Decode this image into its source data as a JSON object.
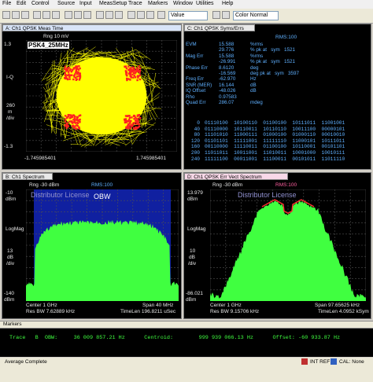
{
  "menu": [
    "File",
    "Edit",
    "Control",
    "Source",
    "Input",
    "MeasSetup",
    "Trace",
    "Markers",
    "Window",
    "Utilities",
    "Help"
  ],
  "toolbar": {
    "value_display": "Value",
    "color_mode": "Color Normal"
  },
  "panelA": {
    "title": "A: Ch1 QPSK Meas Time",
    "rng": "Rng 10 mV",
    "overlay_label": "PSK4_25MHz",
    "y_top": "1.3",
    "y_mid_label": "I-Q",
    "y_scale1": "260",
    "y_scale2": "m",
    "y_scale3": "/div",
    "y_bottom": "-1.3",
    "x_left": "-1.745985401",
    "x_right": "1.745985401",
    "scatter_color": "#ffff00",
    "point_color": "#ff2020"
  },
  "panelC": {
    "title": "C: Ch1 QPSK Syms/Errs",
    "rms": "RMS:100",
    "rows": [
      {
        "name": "EVM",
        "value": "15.588",
        "unit": "%rms"
      },
      {
        "name": "",
        "value": "29.776",
        "unit": "% pk at   sym   1521"
      },
      {
        "name": "Mag Err",
        "value": "15.588",
        "unit": "%rms"
      },
      {
        "name": "",
        "value": "-26.991",
        "unit": "% pk at   sym   1521"
      },
      {
        "name": "Phase Err",
        "value": "8.6120",
        "unit": "deg"
      },
      {
        "name": "",
        "value": "-16.569",
        "unit": "deg pk at   sym   3597"
      },
      {
        "name": "Freq Err",
        "value": "-62.970",
        "unit": "Hz"
      },
      {
        "name": "SNR (MER)",
        "value": "16.144",
        "unit": "dB"
      },
      {
        "name": "IQ Offset",
        "value": "-48.026",
        "unit": "dB"
      },
      {
        "name": "Rho",
        "value": "0.97583",
        "unit": ""
      },
      {
        "name": "Quad Err",
        "value": "286.07",
        "unit": "mdeg"
      }
    ],
    "sym_rows": [
      {
        "idx": "0",
        "bits": "01110100  10100110  01100100  10111011  11001001"
      },
      {
        "idx": "40",
        "bits": "01110000  10110011  10110110  10011100  00000101"
      },
      {
        "idx": "80",
        "bits": "11101010  11000111  01000100  01000110  00010010"
      },
      {
        "idx": "120",
        "bits": "01101101  11111001  11111110  11000101  10111011"
      },
      {
        "idx": "160",
        "bits": "00110000  11110011  01100100  10110001  00101101"
      },
      {
        "idx": "200",
        "bits": "11011011  10011001  11010011  10001000  10010111"
      },
      {
        "idx": "240",
        "bits": "11111100  00011001  11100011  00101011  11011110"
      }
    ]
  },
  "panelB": {
    "title": "B: Ch1 Spectrum",
    "rng": "Rng -30 dBm",
    "rms": "RMS:100",
    "watermark": "Distributor License",
    "overlay_label": "OBW",
    "y_top": "-10",
    "y_top_unit": "dBm",
    "y_mid": "LogMag",
    "y_scale": "13",
    "y_scale_unit": "dB",
    "y_scale_div": "/div",
    "y_bottom": "-140",
    "y_bottom_unit": "dBm",
    "center": "Center 1 GHz",
    "span": "Span 40 MHz",
    "rbw": "Res BW 7.62889 kHz",
    "timelen": "TimeLen 196.8211 uSec",
    "trace_color": "#40ff40",
    "band_color": "#1020a0"
  },
  "panelD": {
    "title": "D: Ch1 QPSK Err Vect Spectrum",
    "rng": "Rng -30 dBm",
    "rms": "RMS:100",
    "watermark": "Distributor License",
    "y_top": "13.979",
    "y_top_unit": "dBm",
    "y_mid": "LogMag",
    "y_scale": "10",
    "y_scale_unit": "dB",
    "y_scale_div": "/div",
    "y_bottom": "-86.021",
    "y_bottom_unit": "dBm",
    "center": "Center 1 GHz",
    "span": "Span 97.65625 kHz",
    "rbw": "Res BW 9.15706 kHz",
    "timelen": "TimeLen 4.0952 kSym",
    "trace_color": "#40ff40",
    "peak_color": "#ff3030"
  },
  "markers": {
    "title": "Markers",
    "line": "Trace   B  OBW:     36 009 857.21 Hz      Centroid:        999 939 066.13 Hz      Offset: -60 933.87 Hz"
  },
  "status": {
    "left": "Average Complete",
    "int_ref": "INT REF",
    "cal": "CAL: None"
  }
}
